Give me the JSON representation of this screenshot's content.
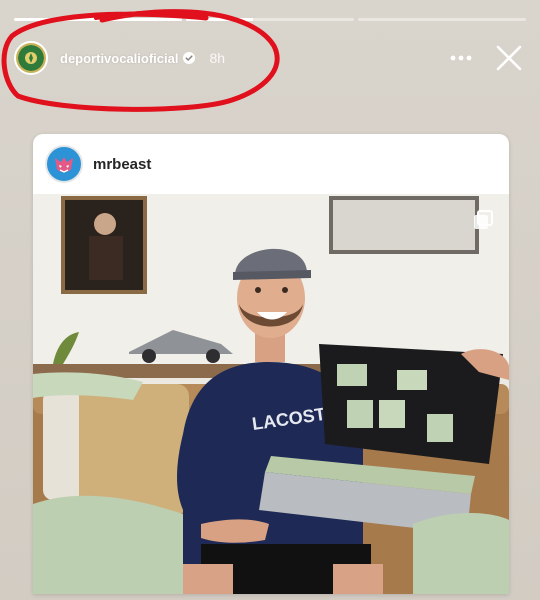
{
  "story": {
    "progress": [
      1.0,
      0.4,
      0.0
    ],
    "account": {
      "username": "deportivocalioficial",
      "verified": true,
      "time_ago": "8h",
      "avatar_icon": "club-crest-icon"
    },
    "controls": {
      "more_icon": "more-dots-icon",
      "close_icon": "close-icon"
    }
  },
  "shared_post": {
    "username": "mrbeast",
    "avatar_icon": "beast-logo-icon",
    "carousel_icon": "carousel-stack-icon",
    "photo": {
      "shirt_text": "LACOSTE"
    }
  },
  "colors": {
    "annotation_red": "#e0101c",
    "story_bg": "#d6d1c9",
    "card_bg": "#ffffff",
    "mrbeast_blue": "#2b93d6"
  }
}
